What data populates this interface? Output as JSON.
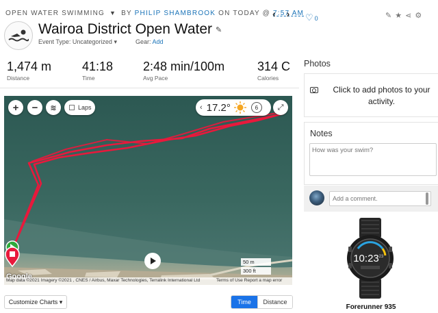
{
  "breadcrumb": {
    "activity_type": "OPEN WATER SWIMMING",
    "by": "BY",
    "author": "PHILIP SHAMBROOK",
    "on": "ON TODAY @",
    "time": "7:57 AM"
  },
  "nav": {
    "prev": "‹",
    "next": "›"
  },
  "activity": {
    "title": "Wairoa District Open Water",
    "event_type_label": "Event Type:",
    "event_type_value": "Uncategorized",
    "gear_label": "Gear:",
    "gear_add": "Add"
  },
  "stats": [
    {
      "value": "1,474 m",
      "label": "Distance"
    },
    {
      "value": "41:18",
      "label": "Time"
    },
    {
      "value": "2:48 min/100m",
      "label": "Avg Pace"
    },
    {
      "value": "314 C",
      "label": "Calories"
    }
  ],
  "map": {
    "zoom_in": "+",
    "zoom_out": "−",
    "laps_label": "Laps",
    "temperature": "17.2°",
    "wind_speed": "6",
    "scale_m": "50 m",
    "scale_ft": "300 ft",
    "google_logo": "Google",
    "attribution": "Map data ©2021 Imagery ©2021 , CNES / Airbus, Maxar Technologies, Terralink International Ltd",
    "terms": "Terms of Use   Report a map error",
    "route_color": "#e8193c",
    "start_color": "#2eaa3c",
    "end_color": "#e8193c"
  },
  "charts": {
    "customize_label": "Customize Charts ▾",
    "time_label": "Time",
    "distance_label": "Distance"
  },
  "social": {
    "likes": "0"
  },
  "photos": {
    "heading": "Photos",
    "prompt": "Click to add photos to your activity."
  },
  "notes": {
    "heading": "Notes",
    "placeholder": "How was your swim?"
  },
  "comment": {
    "placeholder": "Add a comment."
  },
  "device": {
    "name": "Forerunner 935",
    "watch_time": "10:23",
    "watch_sec": "23"
  },
  "colors": {
    "accent": "#1a73b8",
    "button_active": "#1a73e8"
  }
}
